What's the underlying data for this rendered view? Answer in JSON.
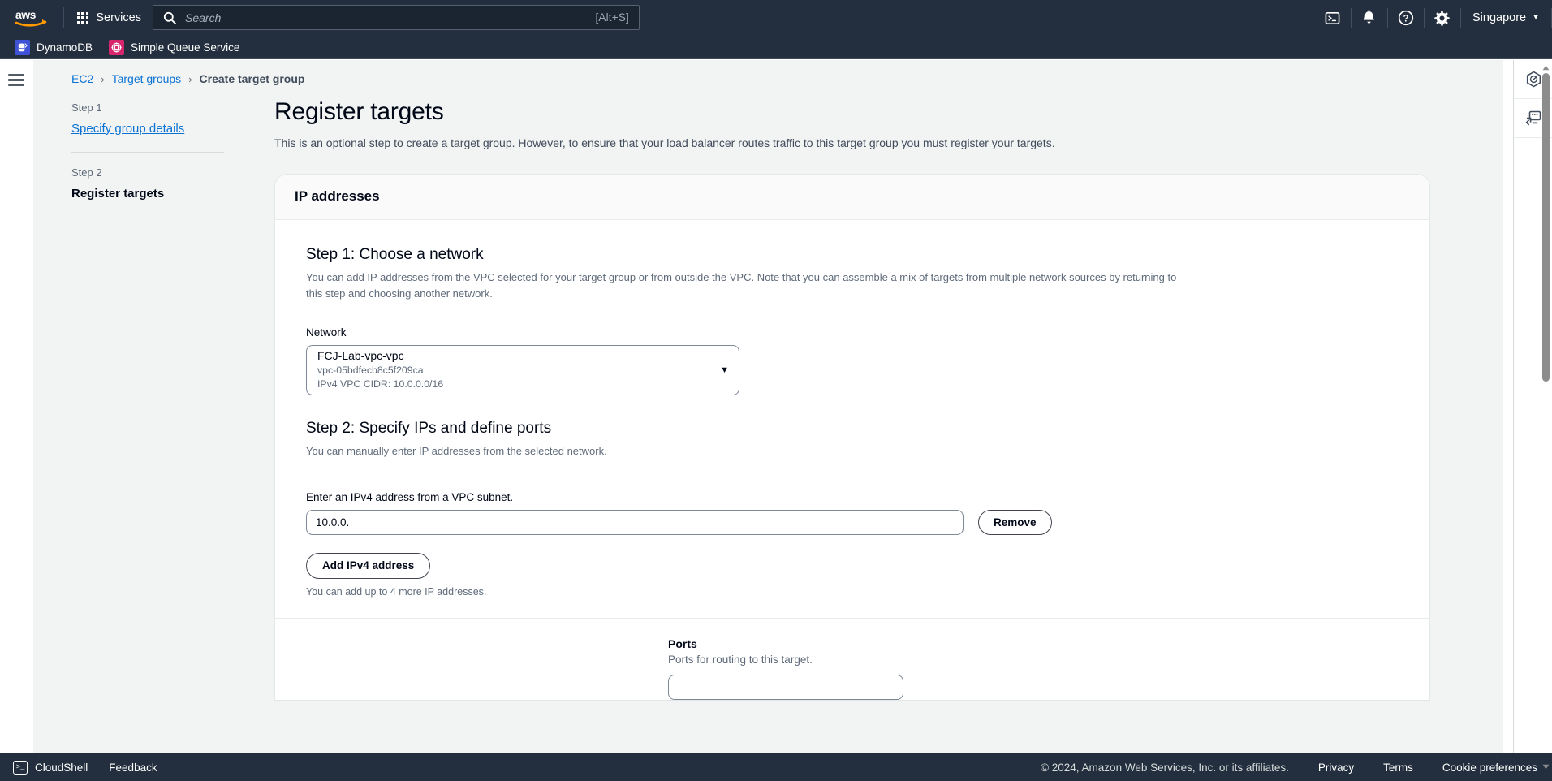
{
  "topnav": {
    "logo_alt": "aws",
    "services_label": "Services",
    "search": {
      "placeholder": "Search",
      "value": "",
      "shortcut": "[Alt+S]"
    },
    "icons": [
      {
        "name": "cloudshell-icon",
        "glyph": ">_"
      },
      {
        "name": "notifications-bell-icon",
        "glyph": "bell"
      },
      {
        "name": "help-question-icon",
        "glyph": "?"
      },
      {
        "name": "settings-gear-icon",
        "glyph": "gear"
      }
    ],
    "region": {
      "label": "Singapore",
      "caret": "▼"
    }
  },
  "favorites": [
    {
      "label": "DynamoDB",
      "color": "#4053d6",
      "icon": "dynamodb-icon"
    },
    {
      "label": "Simple Queue Service",
      "color": "#d6276e",
      "icon": "sqs-icon"
    }
  ],
  "breadcrumb": {
    "items": [
      {
        "label": "EC2",
        "link": true
      },
      {
        "label": "Target groups",
        "link": true
      },
      {
        "label": "Create target group",
        "link": false
      }
    ],
    "separator": "›"
  },
  "steps": [
    {
      "step_label": "Step 1",
      "title": "Specify group details",
      "current": false
    },
    {
      "step_label": "Step 2",
      "title": "Register targets",
      "current": true
    }
  ],
  "main": {
    "title": "Register targets",
    "description": "This is an optional step to create a target group. However, to ensure that your load balancer routes traffic to this target group you must register your targets.",
    "card_title": "IP addresses",
    "step1": {
      "heading": "Step 1: Choose a network",
      "description": "You can add IP addresses from the VPC selected for your target group or from outside the VPC. Note that you can assemble a mix of targets from multiple network sources by returning to this step and choosing another network.",
      "network_label": "Network",
      "network_value": "FCJ-Lab-vpc-vpc",
      "network_id": "vpc-05bdfecb8c5f209ca",
      "network_cidr": "IPv4 VPC CIDR: 10.0.0.0/16",
      "caret": "▼"
    },
    "step2": {
      "heading": "Step 2: Specify IPs and define ports",
      "description": "You can manually enter IP addresses from the selected network.",
      "ip_label": "Enter an IPv4 address from a VPC subnet.",
      "ip_value": "10.0.0.",
      "ip_placeholder": "",
      "remove_label": "Remove",
      "add_label": "Add IPv4 address",
      "hint": "You can add up to 4 more IP addresses."
    },
    "ports": {
      "title": "Ports",
      "description": "Ports for routing to this target.",
      "value": "",
      "placeholder": ""
    }
  },
  "rightrail": [
    {
      "name": "cloudwatch-hexagon-icon"
    },
    {
      "name": "cloudshell-panel-icon"
    }
  ],
  "footer": {
    "cloudshell": "CloudShell",
    "feedback": "Feedback",
    "copyright": "© 2024, Amazon Web Services, Inc. or its affiliates.",
    "links": [
      "Privacy",
      "Terms",
      "Cookie preferences"
    ]
  },
  "colors": {
    "nav_bg": "#232f3e",
    "link_blue": "#0972d3",
    "page_bg": "#f2f3f3",
    "card_bg": "#ffffff",
    "border": "#7d8998"
  }
}
